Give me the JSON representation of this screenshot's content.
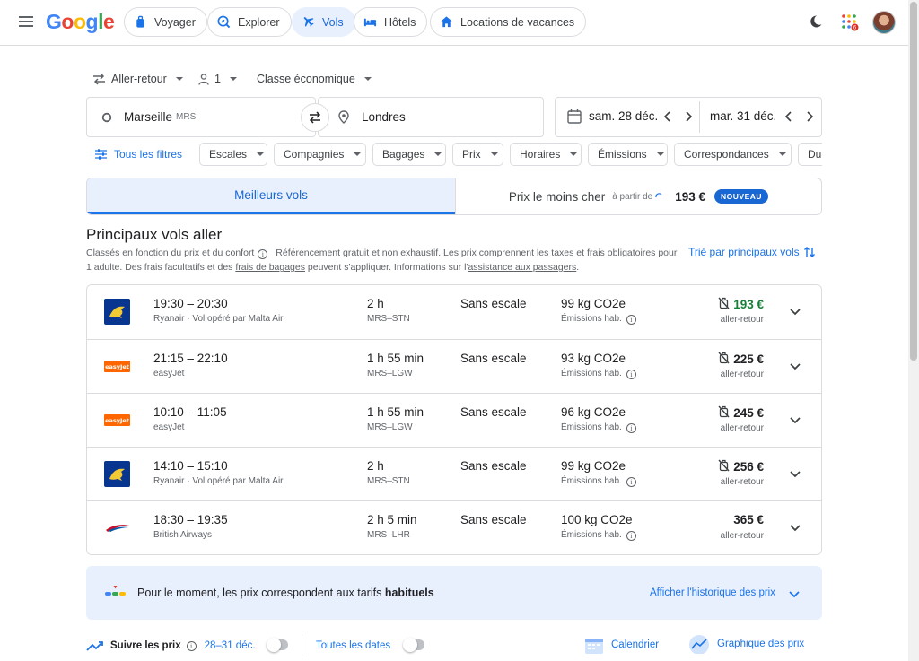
{
  "header": {
    "logo_text": "Google",
    "nav": [
      {
        "label": "Voyager",
        "icon": "suitcase-icon"
      },
      {
        "label": "Explorer",
        "icon": "explore-icon"
      },
      {
        "label": "Vols",
        "icon": "flight-icon",
        "active": true
      },
      {
        "label": "Hôtels",
        "icon": "hotel-bed-icon"
      },
      {
        "label": "Locations de vacances",
        "icon": "home-icon"
      }
    ],
    "notification_count": "6"
  },
  "search": {
    "trip_type": "Aller-retour",
    "passengers": "1",
    "cabin_class": "Classe économique",
    "origin": "Marseille",
    "origin_code": "MRS",
    "destination": "Londres",
    "depart_date": "sam. 28 déc.",
    "return_date": "mar. 31 déc."
  },
  "filters": {
    "all_filters_label": "Tous les filtres",
    "chips": [
      "Escales",
      "Compagnies",
      "Bagages",
      "Prix",
      "Horaires",
      "Émissions",
      "Correspondances",
      "Durée"
    ]
  },
  "sort_tabs": {
    "best_label": "Meilleurs vols",
    "cheapest_label": "Prix le moins cher",
    "cheapest_from": "à partir de",
    "cheapest_price": "193 €",
    "new_badge": "NOUVEAU"
  },
  "results": {
    "title": "Principaux vols aller",
    "desc_part1": "Classés en fonction du prix et du confort",
    "desc_part2": "Référencement gratuit et non exhaustif. Les prix comprennent les taxes et frais obligatoires pour 1 adulte. Des frais facultatifs et des",
    "desc_link1": "frais de bagages",
    "desc_part3": "peuvent s'appliquer. Informations sur l'",
    "desc_link2": "assistance aux passagers",
    "desc_part4": ".",
    "sort_label": "Trié par principaux vols",
    "flights": [
      {
        "times": "19:30 – 20:30",
        "airline": "Ryanair · Vol opéré par Malta Air",
        "logo": "ryanair",
        "duration": "2 h",
        "route": "MRS–STN",
        "stops": "Sans escale",
        "co2": "99 kg CO2e",
        "co2_sub": "Émissions hab.",
        "price": "193 €",
        "price_sub": "aller-retour",
        "price_green": true,
        "no_bag": true
      },
      {
        "times": "21:15 – 22:10",
        "airline": "easyJet",
        "logo": "easyjet",
        "duration": "1 h 55 min",
        "route": "MRS–LGW",
        "stops": "Sans escale",
        "co2": "93 kg CO2e",
        "co2_sub": "Émissions hab.",
        "price": "225 €",
        "price_sub": "aller-retour",
        "price_green": false,
        "no_bag": true
      },
      {
        "times": "10:10 – 11:05",
        "airline": "easyJet",
        "logo": "easyjet",
        "duration": "1 h 55 min",
        "route": "MRS–LGW",
        "stops": "Sans escale",
        "co2": "96 kg CO2e",
        "co2_sub": "Émissions hab.",
        "price": "245 €",
        "price_sub": "aller-retour",
        "price_green": false,
        "no_bag": true
      },
      {
        "times": "14:10 – 15:10",
        "airline": "Ryanair · Vol opéré par Malta Air",
        "logo": "ryanair",
        "duration": "2 h",
        "route": "MRS–STN",
        "stops": "Sans escale",
        "co2": "99 kg CO2e",
        "co2_sub": "Émissions hab.",
        "price": "256 €",
        "price_sub": "aller-retour",
        "price_green": false,
        "no_bag": true
      },
      {
        "times": "18:30 – 19:35",
        "airline": "British Airways",
        "logo": "british-airways",
        "duration": "2 h 5 min",
        "route": "MRS–LHR",
        "stops": "Sans escale",
        "co2": "100 kg CO2e",
        "co2_sub": "Émissions hab.",
        "price": "365 €",
        "price_sub": "aller-retour",
        "price_green": false,
        "no_bag": false
      }
    ]
  },
  "insight": {
    "text_prefix": "Pour le moment, les prix correspondent aux tarifs",
    "text_bold": "habituels",
    "history_link": "Afficher l'historique des prix"
  },
  "bottom": {
    "track_label": "Suivre les prix",
    "track_dates": "28–31 déc.",
    "all_dates": "Toutes les dates",
    "calendar": "Calendrier",
    "price_graph": "Graphique des prix"
  },
  "colors": {
    "accent": "#1a73e8",
    "price_green": "#188038",
    "ryanair_blue": "#073590",
    "easyjet_orange": "#ff6600"
  }
}
